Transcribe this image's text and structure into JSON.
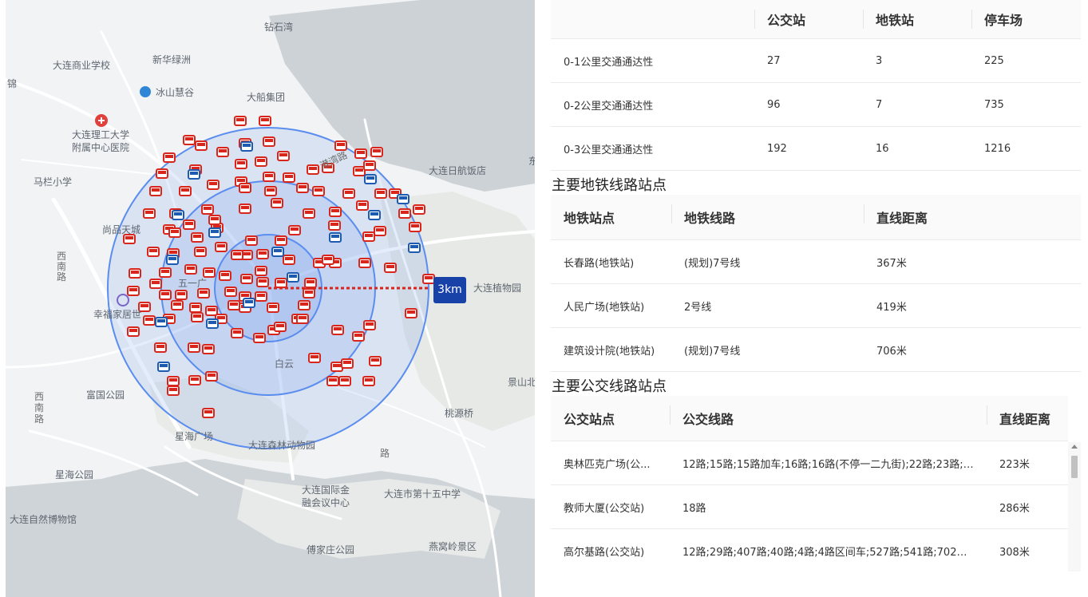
{
  "map": {
    "radius_label": "3km",
    "labels": [
      {
        "text": "大连商业学校",
        "kind": "poi"
      },
      {
        "text": "新华绿洲",
        "kind": "poi"
      },
      {
        "text": "钻石湾",
        "kind": "poi"
      },
      {
        "text": "冰山慧谷",
        "kind": "poi"
      },
      {
        "text": "大船集团",
        "kind": "poi"
      },
      {
        "text": "锦",
        "kind": "poi"
      },
      {
        "text": "大连理工大学",
        "kind": "poi"
      },
      {
        "text": "附属中心医院",
        "kind": "poi"
      },
      {
        "text": "马栏小学",
        "kind": "poi"
      },
      {
        "text": "尚品天城",
        "kind": "poi"
      },
      {
        "text": "西南路",
        "kind": "road"
      },
      {
        "text": "五一广",
        "kind": "poi"
      },
      {
        "text": "幸福家居世",
        "kind": "poi"
      },
      {
        "text": "港湾路",
        "kind": "road"
      },
      {
        "text": "大连日航饭店",
        "kind": "poi"
      },
      {
        "text": "东",
        "kind": "poi"
      },
      {
        "text": "大连植物园",
        "kind": "poi"
      },
      {
        "text": "景山北",
        "kind": "poi"
      },
      {
        "text": "桃源桥",
        "kind": "poi"
      },
      {
        "text": "西南路",
        "kind": "road"
      },
      {
        "text": "富国公园",
        "kind": "poi"
      },
      {
        "text": "星海广场",
        "kind": "poi"
      },
      {
        "text": "大连森林动物园",
        "kind": "poi"
      },
      {
        "text": "星海公园",
        "kind": "poi"
      },
      {
        "text": "大连国际金",
        "kind": "poi"
      },
      {
        "text": "融会议中心",
        "kind": "poi"
      },
      {
        "text": "大连市第十五中学",
        "kind": "poi"
      },
      {
        "text": "大连自然博物馆",
        "kind": "poi"
      },
      {
        "text": "傅家庄公园",
        "kind": "poi"
      },
      {
        "text": "燕窝岭景区",
        "kind": "poi"
      },
      {
        "text": "白云",
        "kind": "poi"
      },
      {
        "text": "路",
        "kind": "road"
      }
    ]
  },
  "traffic_summary": {
    "headers": [
      "",
      "公交站",
      "地铁站",
      "停车场"
    ],
    "rows": [
      [
        "0-1公里交通通达性",
        "27",
        "3",
        "225"
      ],
      [
        "0-2公里交通通达性",
        "96",
        "7",
        "735"
      ],
      [
        "0-3公里交通通达性",
        "192",
        "16",
        "1216"
      ]
    ]
  },
  "metro": {
    "title": "主要地铁线路站点",
    "headers": [
      "地铁站点",
      "地铁线路",
      "直线距离"
    ],
    "rows": [
      [
        "长春路(地铁站)",
        "(规划)7号线",
        "367米"
      ],
      [
        "人民广场(地铁站)",
        "2号线",
        "419米"
      ],
      [
        "建筑设计院(地铁站)",
        "(规划)7号线",
        "706米"
      ]
    ]
  },
  "bus": {
    "title": "主要公交线路站点",
    "headers": [
      "公交站点",
      "公交线路",
      "直线距离"
    ],
    "rows": [
      [
        "奥林匹克广场(公...",
        "12路;15路;15路加车;16路;16路(不停一二九街);22路;23路;4...",
        "223米"
      ],
      [
        "教师大厦(公交站)",
        "18路",
        "286米"
      ],
      [
        "高尔基路(公交站)",
        "12路;29路;407路;40路;4路;4路区间车;527路;541路;702路;7...",
        "308米"
      ]
    ]
  },
  "colors": {
    "bus_marker": "#d9261c",
    "metro_marker": "#1c5bb0",
    "ring": "#5b8def",
    "radius_line": "#d9261c",
    "km_tag": "#1842a8"
  }
}
